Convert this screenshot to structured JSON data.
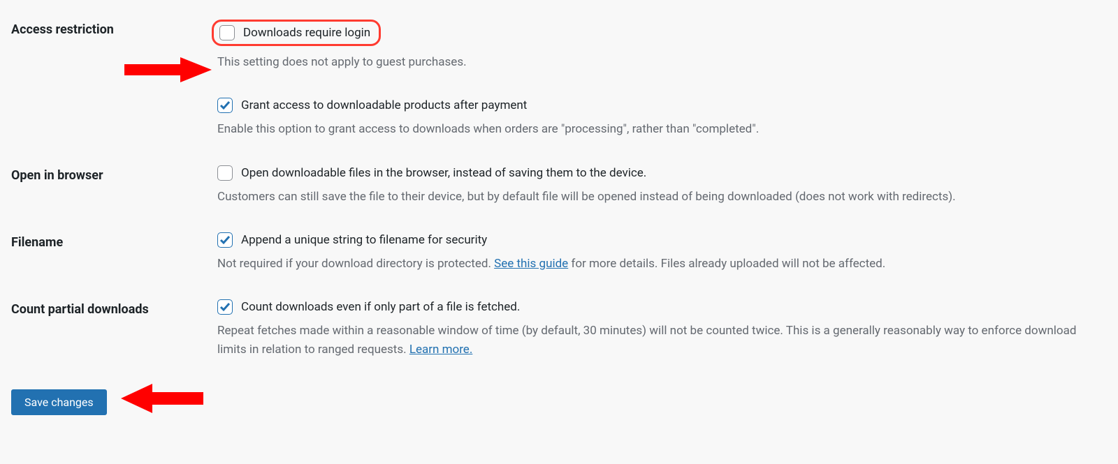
{
  "rows": {
    "access_restriction": {
      "heading": "Access restriction",
      "option1_label": "Downloads require login",
      "option1_checked": false,
      "option1_desc": "This setting does not apply to guest purchases.",
      "option2_label": "Grant access to downloadable products after payment",
      "option2_checked": true,
      "option2_desc": "Enable this option to grant access to downloads when orders are \"processing\", rather than \"completed\"."
    },
    "open_in_browser": {
      "heading": "Open in browser",
      "option_label": "Open downloadable files in the browser, instead of saving them to the device.",
      "option_checked": false,
      "desc": "Customers can still save the file to their device, but by default file will be opened instead of being downloaded (does not work with redirects)."
    },
    "filename": {
      "heading": "Filename",
      "option_label": "Append a unique string to filename for security",
      "option_checked": true,
      "desc_pre": "Not required if your download directory is protected. ",
      "desc_link": "See this guide",
      "desc_post": " for more details. Files already uploaded will not be affected."
    },
    "count_partial": {
      "heading": "Count partial downloads",
      "option_label": "Count downloads even if only part of a file is fetched.",
      "option_checked": true,
      "desc_pre": "Repeat fetches made within a reasonable window of time (by default, 30 minutes) will not be counted twice. This is a generally reasonably way to enforce download limits in relation to ranged requests. ",
      "desc_link": "Learn more."
    }
  },
  "save_button": "Save changes",
  "annotations": {
    "highlight": "downloads-require-login",
    "arrows": [
      "grant-access-checkbox",
      "save-button"
    ]
  }
}
